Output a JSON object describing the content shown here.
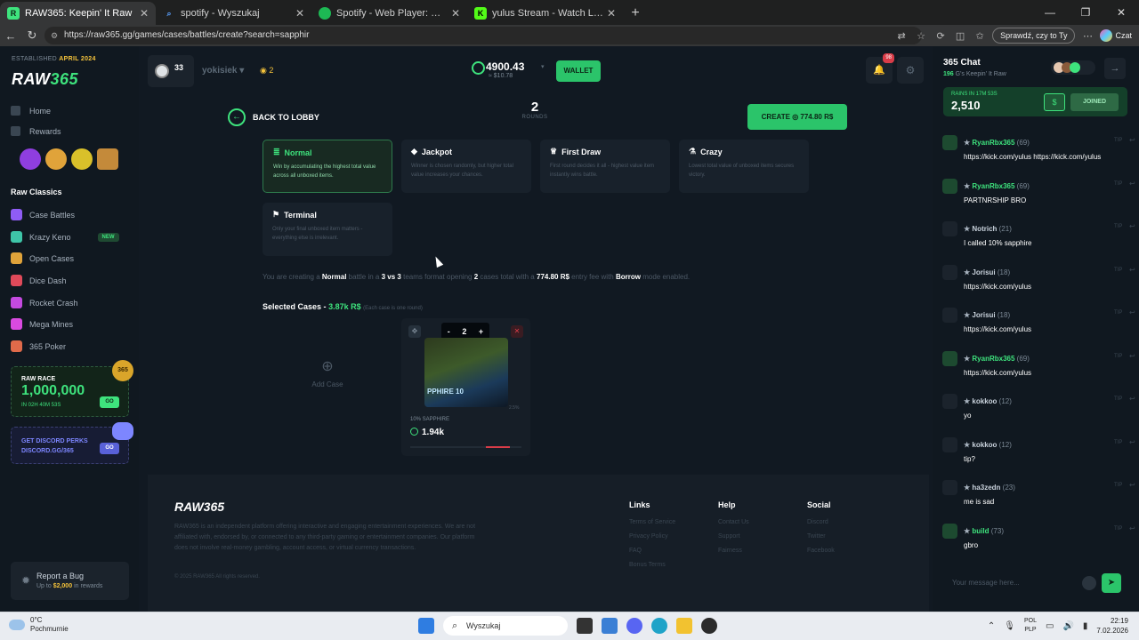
{
  "browser": {
    "tabs": [
      {
        "label": "RAW365: Keepin' It Raw",
        "active": true,
        "icon": "raw365-favicon"
      },
      {
        "label": "spotify - Wyszukaj",
        "active": false,
        "icon": "search-favicon"
      },
      {
        "label": "Spotify - Web Player: Music for ev",
        "active": false,
        "icon": "spotify-favicon"
      },
      {
        "label": "yulus Stream - Watch Live on Kick",
        "active": false,
        "icon": "kick-favicon"
      }
    ],
    "url": "https://raw365.gg/games/cases/battles/create?search=sapphir",
    "check_button": "Sprawdź, czy to Ty",
    "copilot_label": "Czat"
  },
  "sidebar": {
    "established": "ESTABLISHED",
    "established_date": "APRIL 2024",
    "logo_a": "RAW",
    "logo_b": "365",
    "nav": [
      {
        "label": "Home"
      },
      {
        "label": "Rewards"
      }
    ],
    "section_title": "Raw Classics",
    "games": [
      {
        "label": "Case Battles",
        "color": "#8f5cf5"
      },
      {
        "label": "Krazy Keno",
        "color": "#3ec5a8",
        "badge": "NEW"
      },
      {
        "label": "Open Cases",
        "color": "#e0a33a"
      },
      {
        "label": "Dice Dash",
        "color": "#e04a5a"
      },
      {
        "label": "Rocket Crash",
        "color": "#c44ae0"
      },
      {
        "label": "Mega Mines",
        "color": "#d94ae0"
      },
      {
        "label": "365 Poker",
        "color": "#e06a4a"
      }
    ],
    "race": {
      "label": "RAW RACE",
      "value": "1,000,000",
      "time": "IN 02H 40M 53S",
      "go": "GO"
    },
    "discord": {
      "line1": "GET DISCORD PERKS",
      "line2": "DISCORD.GG/365",
      "go": "GO"
    },
    "bug": {
      "title": "Report a Bug",
      "sub_prefix": "Up to",
      "sub_amount": "$2,000",
      "sub_suffix": "in rewards"
    }
  },
  "topbar": {
    "level": "33",
    "username": "yokisiek",
    "coins": "2",
    "balance": "4900.43",
    "balance_usd": "≈ $10.78",
    "wallet": "WALLET",
    "notifications": "98"
  },
  "battle": {
    "back": "BACK TO LOBBY",
    "rounds_value": "2",
    "rounds_label": "ROUNDS",
    "create": "CREATE",
    "create_amount": "774.80 R$",
    "modes": [
      {
        "name": "Normal",
        "desc": "Win by accumulating the highest total value across all unboxed items.",
        "icon": "stack-icon",
        "selected": true
      },
      {
        "name": "Jackpot",
        "desc": "Winner is chosen randomly, but higher total value increases your chances.",
        "icon": "diamond-icon",
        "selected": false
      },
      {
        "name": "First Draw",
        "desc": "First round decides it all - highest value item instantly wins battle.",
        "icon": "trophy-icon",
        "selected": false
      },
      {
        "name": "Crazy",
        "desc": "Lowest total value of unboxed items secures victory.",
        "icon": "crazy-icon",
        "selected": false
      },
      {
        "name": "Terminal",
        "desc": "Only your final unboxed item matters - everything else is irrelevant.",
        "icon": "flag-icon",
        "selected": false
      }
    ],
    "summary": {
      "p1": "You are creating a",
      "mode": "Normal",
      "p2": "battle in a",
      "format": "3 vs 3",
      "p3": "teams format opening",
      "cases": "2",
      "p4": "cases total with a",
      "fee": "774.80 R$",
      "p5": "entry fee with",
      "borrow": "Borrow",
      "p6": "mode enabled."
    },
    "selected_title": "Selected Cases -",
    "selected_value": "3.87k R$",
    "selected_note": "(Each case is one round)",
    "add_case": "Add Case",
    "case": {
      "qty": "2",
      "minus": "-",
      "plus": "+",
      "image_label": "PPHIRE 10",
      "pct": "2.5%",
      "name": "10% SAPPHIRE",
      "price": "1.94k",
      "progress": 0.25
    }
  },
  "footer": {
    "logo": "RAW365",
    "desc": "RAW365 is an independent platform offering interactive and engaging entertainment experiences. We are not affiliated with, endorsed by, or connected to any third-party gaming or entertainment companies. Our platform does not involve real-money gambling, account access, or virtual currency transactions.",
    "copyright": "© 2025 RAW365 All rights reserved.",
    "columns": [
      {
        "title": "Links",
        "items": [
          "Terms of Service",
          "Privacy Policy",
          "FAQ",
          "Bonus Terms"
        ]
      },
      {
        "title": "Help",
        "items": [
          "Contact Us",
          "Support",
          "Fairness"
        ]
      },
      {
        "title": "Social",
        "items": [
          "Discord",
          "Twitter",
          "Facebook"
        ]
      }
    ]
  },
  "chat": {
    "title": "365 Chat",
    "online_count": "196",
    "online_suffix": "G's Keepin' It Raw",
    "rain_label": "RAINS IN 17M 53S",
    "rain_value": "2,510",
    "joined": "JOINED",
    "messages": [
      {
        "name": "RyanRbx365",
        "level": "(69)",
        "text": "https://kick.com/yulus https://kick.com/yulus",
        "highlight": true
      },
      {
        "name": "RyanRbx365",
        "level": "(69)",
        "text": "PARTNRSHIP BRO",
        "highlight": true
      },
      {
        "name": "Notrich",
        "level": "(21)",
        "text": "I called 10% sapphire",
        "highlight": false
      },
      {
        "name": "Jorisui",
        "level": "(18)",
        "text": "https://kick.com/yulus",
        "highlight": false
      },
      {
        "name": "Jorisui",
        "level": "(18)",
        "text": "https://kick.com/yulus",
        "highlight": false
      },
      {
        "name": "RyanRbx365",
        "level": "(69)",
        "text": "https://kick.com/yulus",
        "highlight": true
      },
      {
        "name": "kokkoo",
        "level": "(12)",
        "text": "yo",
        "highlight": false
      },
      {
        "name": "kokkoo",
        "level": "(12)",
        "text": "tip?",
        "highlight": false
      },
      {
        "name": "ha3zedn",
        "level": "(23)",
        "text": "me is sad",
        "highlight": false
      },
      {
        "name": "build",
        "level": "(73)",
        "text": "gbro",
        "highlight": true
      }
    ],
    "tip_label": "TIP",
    "placeholder": "Your message here..."
  },
  "taskbar": {
    "temp": "0°C",
    "weather": "Pochmurnie",
    "search": "Wyszukaj",
    "lang1": "POL",
    "lang2": "PLP",
    "time": "22:19",
    "date": "7.02.2026"
  }
}
